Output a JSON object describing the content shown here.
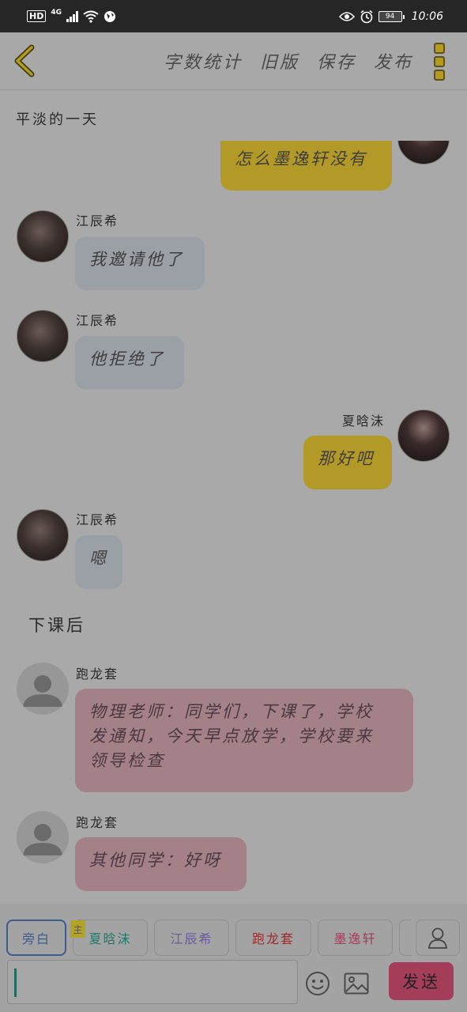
{
  "status_bar": {
    "hd": "HD",
    "network": "4G",
    "battery": "94",
    "time": "10:06"
  },
  "header": {
    "actions": [
      "字数统计",
      "旧版",
      "保存",
      "发布"
    ]
  },
  "doc_title": "平淡的一天",
  "messages": [
    {
      "text": "怎么墨逸轩没有"
    },
    {
      "sender": "江辰希",
      "text": "我邀请他了"
    },
    {
      "sender": "江辰希",
      "text": "他拒绝了"
    },
    {
      "sender": "夏晗沫",
      "text": "那好吧"
    },
    {
      "sender": "江辰希",
      "text": "嗯"
    },
    {
      "narration": "下课后"
    },
    {
      "sender": "跑龙套",
      "text_lines": [
        "物理老师：同学们，下课了，学校",
        "发通知，今天早点放学，学校要来",
        "领导检查"
      ]
    },
    {
      "sender": "跑龙套",
      "text": "其他同学：好呀"
    }
  ],
  "roles": {
    "items": [
      "旁白",
      "夏晗沫",
      "江辰希",
      "跑龙套",
      "墨逸轩"
    ],
    "main_badge": "主",
    "colors": [
      "#3c5c8e",
      "#1e7a6a",
      "#6a5a9e",
      "#9e2a2a",
      "#a83a5a"
    ]
  },
  "composer": {
    "send_label": "发送"
  },
  "colors": {
    "yellow_bubble": "#b39a28",
    "grey_bubble": "#9b9fa6",
    "pink_bubble": "#a48189",
    "send_button": "#a43d5a"
  }
}
